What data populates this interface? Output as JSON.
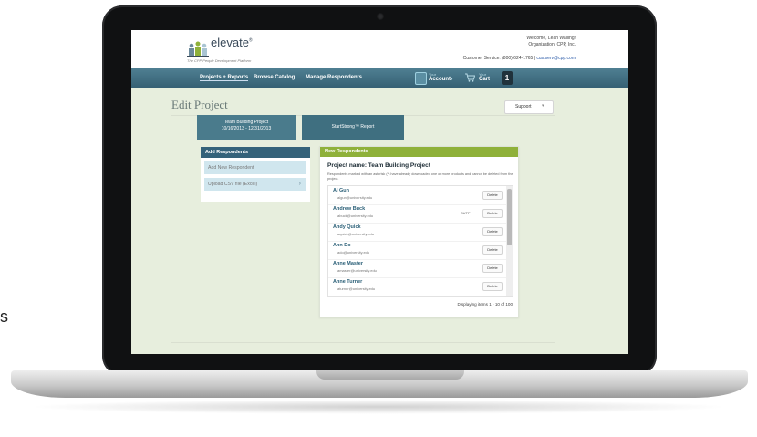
{
  "edge_text": "s",
  "header": {
    "logo": "elevate",
    "logo_mark": "®",
    "tagline": "The CPP People Development Platform",
    "welcome": "Welcome, Leah Walling!",
    "organization": "Organization: CPP, Inc.",
    "customer_service": "Customer Service: (800) 624-1765 |",
    "email": "custserv@cpp.com"
  },
  "nav": {
    "items": [
      "Projects + Reports",
      "Browse Catalog",
      "Manage Respondents"
    ],
    "account_small": "Your",
    "account_label": "Account",
    "account_caret": "▾",
    "cart_small": "Your",
    "cart_label": "Cart",
    "cart_count": "1"
  },
  "page": {
    "title": "Edit Project",
    "support_label": "Support",
    "support_caret": "▾"
  },
  "project_tabs": [
    {
      "line1": "Team Building Project",
      "line2": "10/16/2013 - 12/31/2013"
    },
    {
      "line1": "StartStrong™ Report",
      "line2": ""
    }
  ],
  "add_panel": {
    "header": "Add Respondents",
    "rows": [
      "Add New Respondent",
      "Upload CSV file (Excel)"
    ],
    "chevron": "›"
  },
  "new_panel": {
    "header": "New Respondents",
    "project_name": "Project name: Team Building Project",
    "note": "Respondents marked with an asterisk (*) have already downloaded one or more products and cannot be deleted from the project.",
    "respondents": [
      {
        "name": "Al Gun",
        "email": "algun@university.edu",
        "badge": ""
      },
      {
        "name": "Andrew Buck",
        "email": "abuck@university.edu",
        "badge": "SUTP"
      },
      {
        "name": "Andy Quick",
        "email": "aquick@university.edu",
        "badge": ""
      },
      {
        "name": "Ann Do",
        "email": "ado@university.edu",
        "badge": ""
      },
      {
        "name": "Anne Master",
        "email": "amaster@university.edu",
        "badge": ""
      },
      {
        "name": "Anne Turner",
        "email": "aturner@university.edu",
        "badge": ""
      }
    ],
    "delete_label": "Delete",
    "displaying": "Displaying items 1 - 10 of 100"
  },
  "colors": {
    "nav": "#3f6f80",
    "accent_green": "#8fb13a",
    "page_bg": "#e7eedd"
  }
}
